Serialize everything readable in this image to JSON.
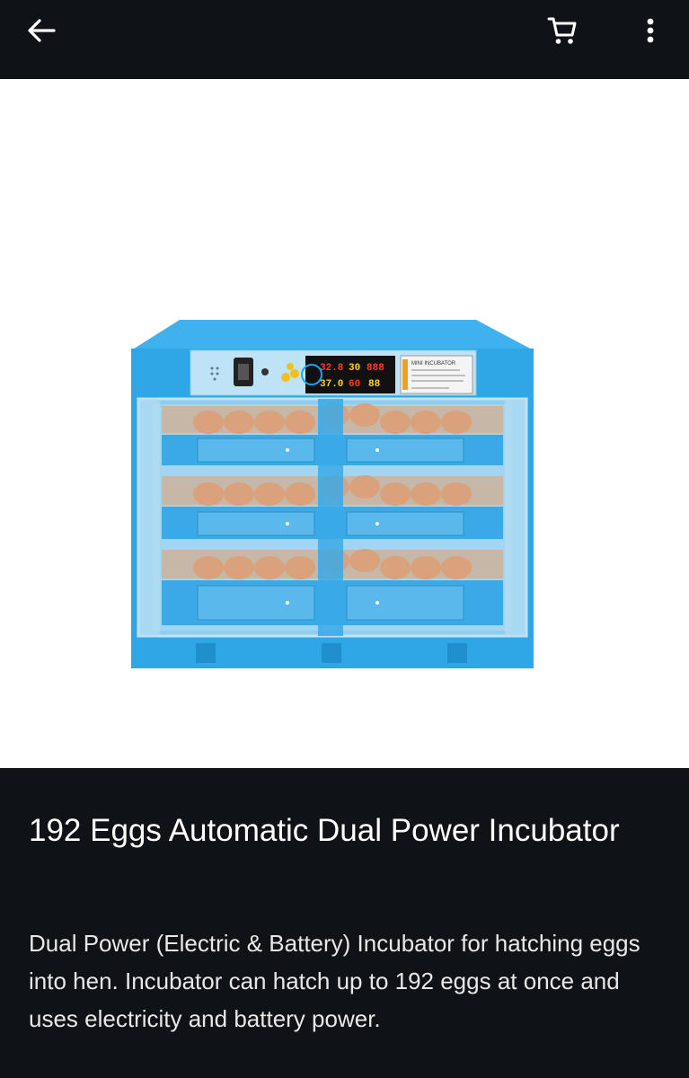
{
  "appbar": {
    "back_icon": "arrow-left-icon",
    "cart_icon": "shopping-cart-icon",
    "menu_icon": "more-vertical-icon"
  },
  "product": {
    "image_subject": "blue egg incubator with three trays of eggs",
    "display_readout": [
      "32.8",
      "30",
      "888",
      "37.0",
      "60",
      "88"
    ],
    "label_heading": "MINI INCUBATOR",
    "title": "192 Eggs Automatic Dual Power Incubator",
    "description": "Dual Power (Electric & Battery) Incubator for hatching eggs into hen. Incubator can hatch up to 192 eggs at once and uses electricity and battery power."
  },
  "colors": {
    "background": "#0f1216",
    "image_background": "#ffffff",
    "incubator_blue": "#2ea7e6",
    "egg": "#d9a27c"
  }
}
